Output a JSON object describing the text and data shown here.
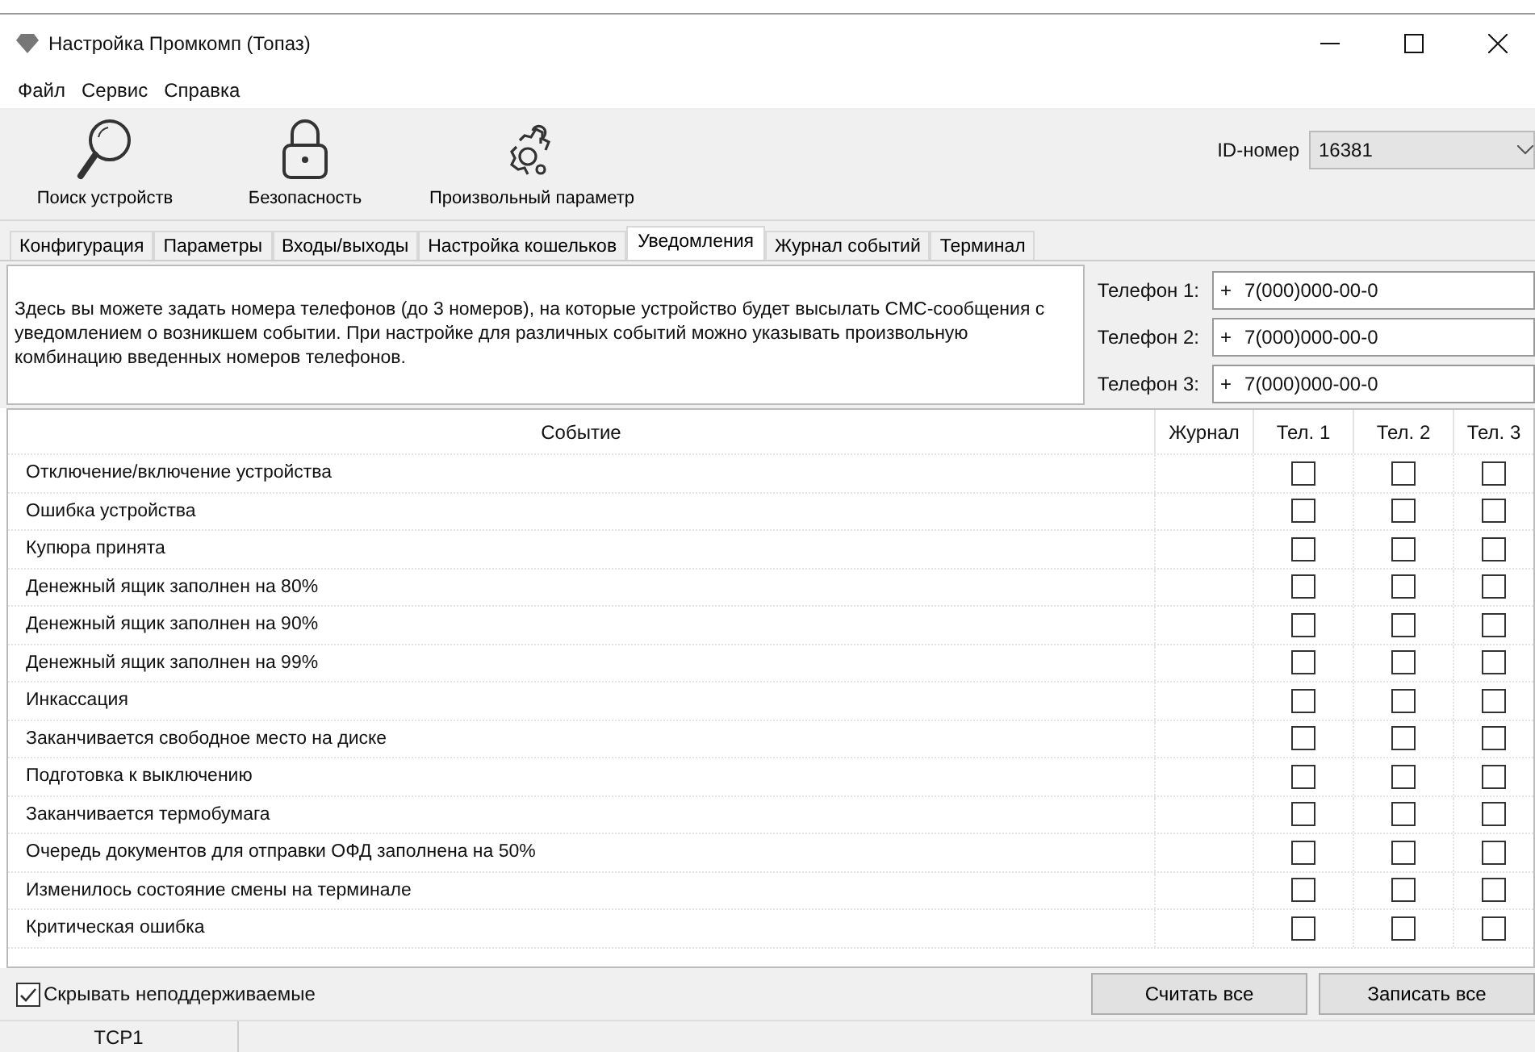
{
  "window": {
    "title": "Настройка Промкомп (Топаз)"
  },
  "menu": [
    "Файл",
    "Сервис",
    "Справка"
  ],
  "toolbar": [
    {
      "kind": "search",
      "label": "Поиск устройств"
    },
    {
      "kind": "lock",
      "label": "Безопасность"
    },
    {
      "kind": "gear",
      "label": "Произвольный параметр"
    }
  ],
  "id_field": {
    "label": "ID-номер",
    "value": "16381"
  },
  "tabs": [
    {
      "label": "Конфигурация",
      "selected": false
    },
    {
      "label": "Параметры",
      "selected": false
    },
    {
      "label": "Входы/выходы",
      "selected": false
    },
    {
      "label": "Настройка кошельков",
      "selected": false
    },
    {
      "label": "Уведомления",
      "selected": true
    },
    {
      "label": "Журнал событий",
      "selected": false
    },
    {
      "label": "Терминал",
      "selected": false
    }
  ],
  "description": "Здесь вы можете задать номера телефонов (до 3 номеров), на которые устройство будет высылать СМС-сообщения с уведомлением о возникшем событии. При настройке для различных событий можно указывать произвольную комбинацию введенных номеров телефонов.",
  "phones": [
    {
      "label": "Телефон 1:",
      "prefix": "+",
      "value": "7(000)000-00-0"
    },
    {
      "label": "Телефон 2:",
      "prefix": "+",
      "value": "7(000)000-00-0"
    },
    {
      "label": "Телефон 3:",
      "prefix": "+",
      "value": "7(000)000-00-0"
    }
  ],
  "table": {
    "columns": [
      "Событие",
      "Журнал",
      "Тел. 1",
      "Тел. 2",
      "Тел. 3"
    ],
    "rows": [
      {
        "event": "Отключение/включение устройства",
        "tel": [
          false,
          false,
          false
        ]
      },
      {
        "event": "Ошибка устройства",
        "tel": [
          false,
          false,
          false
        ]
      },
      {
        "event": "Купюра принята",
        "tel": [
          false,
          false,
          false
        ]
      },
      {
        "event": "Денежный ящик заполнен на 80%",
        "tel": [
          false,
          false,
          false
        ]
      },
      {
        "event": "Денежный ящик заполнен на 90%",
        "tel": [
          false,
          false,
          false
        ]
      },
      {
        "event": "Денежный ящик заполнен на 99%",
        "tel": [
          false,
          false,
          false
        ]
      },
      {
        "event": "Инкассация",
        "tel": [
          false,
          false,
          false
        ]
      },
      {
        "event": "Заканчивается свободное место на диске",
        "tel": [
          false,
          false,
          false
        ]
      },
      {
        "event": "Подготовка к выключению",
        "tel": [
          false,
          false,
          false
        ]
      },
      {
        "event": "Заканчивается термобумага",
        "tel": [
          false,
          false,
          false
        ]
      },
      {
        "event": "Очередь документов для отправки ОФД заполнена на 50%",
        "tel": [
          false,
          false,
          false
        ]
      },
      {
        "event": "Изменилось состояние смены на терминале",
        "tel": [
          false,
          false,
          false
        ]
      },
      {
        "event": "Критическая ошибка",
        "tel": [
          false,
          false,
          false
        ]
      }
    ]
  },
  "hide_unsupported": {
    "label": "Скрывать неподдерживаемые",
    "checked": true
  },
  "buttons": [
    "Считать все",
    "Записать все"
  ],
  "status_bar": [
    "TCP1"
  ]
}
